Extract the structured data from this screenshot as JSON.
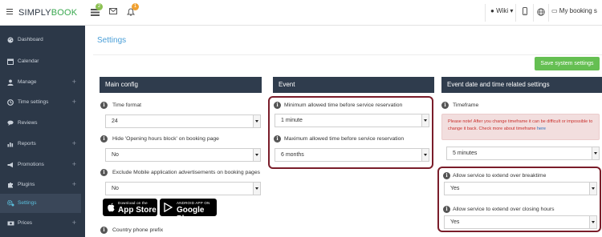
{
  "topbar": {
    "logo_part1": "SIMPLY",
    "logo_part2": "BOOK",
    "badge_tasks": "2",
    "badge_notifications": "1",
    "wiki_label": "Wiki",
    "booking_label": "My booking s"
  },
  "sidebar": {
    "items": [
      {
        "label": "Dashboard",
        "icon": "palette-icon",
        "plus": false
      },
      {
        "label": "Calendar",
        "icon": "calendar-icon",
        "plus": false
      },
      {
        "label": "Manage",
        "icon": "user-icon",
        "plus": true
      },
      {
        "label": "Time settings",
        "icon": "clock-icon",
        "plus": true
      },
      {
        "label": "Reviews",
        "icon": "comments-icon",
        "plus": false
      },
      {
        "label": "Reports",
        "icon": "bar-chart-icon",
        "plus": true
      },
      {
        "label": "Promotions",
        "icon": "megaphone-icon",
        "plus": true
      },
      {
        "label": "Plugins",
        "icon": "puzzle-icon",
        "plus": true
      },
      {
        "label": "Settings",
        "icon": "gears-icon",
        "plus": false,
        "active": true
      },
      {
        "label": "Prices",
        "icon": "money-icon",
        "plus": true
      }
    ],
    "plus_symbol": "+"
  },
  "page": {
    "title": "Settings",
    "save_button": "Save system settings"
  },
  "main_config": {
    "heading": "Main config",
    "time_format_label": "Time format",
    "time_format_value": "24",
    "hide_hours_label": "Hide 'Opening hours block' on booking page",
    "hide_hours_value": "No",
    "exclude_ads_label": "Exclude Mobile application advertisements on booking pages",
    "exclude_ads_value": "No",
    "app_store_small": "Download on the",
    "app_store_big": "App Store",
    "google_play_small": "ANDROID APP ON",
    "google_play_big": "Google Play",
    "country_prefix_label": "Country phone prefix"
  },
  "event": {
    "heading": "Event",
    "min_time_label": "Minimum allowed time before service reservation",
    "min_time_value": "1 minute",
    "max_time_label": "Maximum allowed time before service reservation",
    "max_time_value": "6 months"
  },
  "event_dt": {
    "heading": "Event date and time related settings",
    "timeframe_label": "Timeframe",
    "alert_text": "Please note! After you change timeframe it can be difficult or impossible to change it back. Check more about timeframe",
    "alert_link": "here",
    "timeframe_value": "5 minutes",
    "breaktime_label": "Allow service to extend over breaktime",
    "breaktime_value": "Yes",
    "closing_label": "Allow service to extend over closing hours",
    "closing_value": "Yes"
  },
  "colors": {
    "sidebar_bg": "#2c3848",
    "panel_header": "#2f3c4d",
    "accent_blue": "#4a9fd8",
    "save_green": "#65bf52",
    "highlight_border": "#7a1d2a",
    "badge_green": "#8cc152",
    "badge_orange": "#f0a030"
  }
}
